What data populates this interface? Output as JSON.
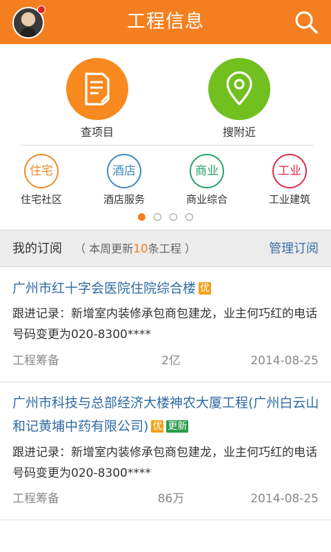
{
  "header": {
    "title": "工程信息",
    "icons": {
      "avatar": "user-avatar",
      "search": "search-icon"
    },
    "colors": {
      "bar": "#f47f20"
    }
  },
  "features": [
    {
      "label": "查项目",
      "icon": "document-icon",
      "color": "#f7891f"
    },
    {
      "label": "搜附近",
      "icon": "location-pin-icon",
      "color": "#72c020"
    }
  ],
  "categories": [
    {
      "icon_text": "住宅",
      "label": "住宅社区",
      "color": "#f08a24"
    },
    {
      "icon_text": "酒店",
      "label": "酒店服务",
      "color": "#3c8bbf"
    },
    {
      "icon_text": "商业",
      "label": "商业综合",
      "color": "#27a06a"
    },
    {
      "icon_text": "工业",
      "label": "工业建筑",
      "color": "#e02a4a"
    }
  ],
  "pager": {
    "pages": 4,
    "active": 1
  },
  "subscription": {
    "title": "我的订阅",
    "update_prefix": "（ 本周更新",
    "update_count": "10",
    "update_suffix": "条工程 ）",
    "manage_label": "管理订阅"
  },
  "items": [
    {
      "title": "广州市红十字会医院住院综合楼",
      "badges": [
        "优"
      ],
      "record": "跟进记录：新增室内装修承包商包建龙，业主何巧红的电话号码变更为020-8300****",
      "status": "工程筹备",
      "amount": "2亿",
      "date": "2014-08-25"
    },
    {
      "title": "广州市科技与总部经济大楼神农大厦工程(广州白云山和记黄埔中药有限公司)",
      "badges": [
        "优",
        "更新"
      ],
      "record": "跟进记录：新增室内装修承包商包建龙，业主何巧红的电话号码变更为020-8300****",
      "status": "工程筹备",
      "amount": "86万",
      "date": "2014-08-25"
    }
  ]
}
